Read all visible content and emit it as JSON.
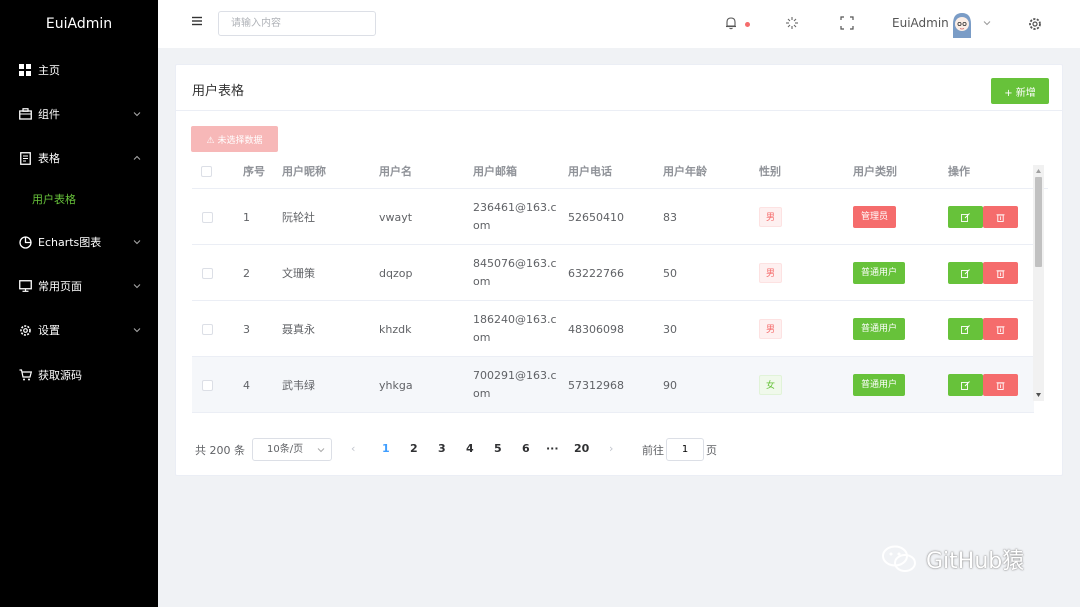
{
  "app": {
    "logo": "EuiAdmin"
  },
  "sidebar": {
    "items": [
      {
        "label": "主页",
        "icon": "grid-icon"
      },
      {
        "label": "组件",
        "icon": "briefcase-icon",
        "expandable": true
      },
      {
        "label": "表格",
        "icon": "document-icon",
        "expandable": true,
        "expanded": true
      },
      {
        "label": "Echarts图表",
        "icon": "pie-chart-icon",
        "expandable": true
      },
      {
        "label": "常用页面",
        "icon": "monitor-icon",
        "expandable": true
      },
      {
        "label": "设置",
        "icon": "gear-icon",
        "expandable": true
      },
      {
        "label": "获取源码",
        "icon": "cart-icon"
      }
    ],
    "sub_item": {
      "label": "用户表格",
      "active_color": "#67c23a"
    }
  },
  "header": {
    "search_placeholder": "请输入内容",
    "username": "EuiAdmin"
  },
  "card": {
    "title": "用户表格",
    "add_button": "+ 新增",
    "batch_button": "未选择数据"
  },
  "table": {
    "columns": [
      "序号",
      "用户昵称",
      "用户名",
      "用户邮箱",
      "用户电话",
      "用户年龄",
      "性别",
      "用户类别",
      "操作"
    ],
    "rows": [
      {
        "no": "1",
        "nickname": "阮轮社",
        "username": "vwayt",
        "email": "236461@163.com",
        "phone": "52650410",
        "age": "83",
        "gender": "男",
        "type": "管理员",
        "type_kind": "admin"
      },
      {
        "no": "2",
        "nickname": "文珊策",
        "username": "dqzop",
        "email": "845076@163.com",
        "phone": "63222766",
        "age": "50",
        "gender": "男",
        "type": "普通用户",
        "type_kind": "normal"
      },
      {
        "no": "3",
        "nickname": "聂真永",
        "username": "khzdk",
        "email": "186240@163.com",
        "phone": "48306098",
        "age": "30",
        "gender": "男",
        "type": "普通用户",
        "type_kind": "normal"
      },
      {
        "no": "4",
        "nickname": "武韦绿",
        "username": "yhkga",
        "email": "700291@163.com",
        "phone": "57312968",
        "age": "90",
        "gender": "女",
        "type": "普通用户",
        "type_kind": "normal"
      }
    ]
  },
  "pagination": {
    "total": "共 200 条",
    "page_size": "10条/页",
    "pages": [
      "1",
      "2",
      "3",
      "4",
      "5",
      "6",
      "···",
      "20"
    ],
    "current": "1",
    "goto_label": "前往",
    "goto_value": "1",
    "page_unit": "页"
  },
  "watermark": {
    "text": "GitHub猿"
  },
  "colors": {
    "success": "#67c23a",
    "danger": "#f56c6c",
    "primary": "#409eff",
    "sidebar_bg": "#000000"
  }
}
